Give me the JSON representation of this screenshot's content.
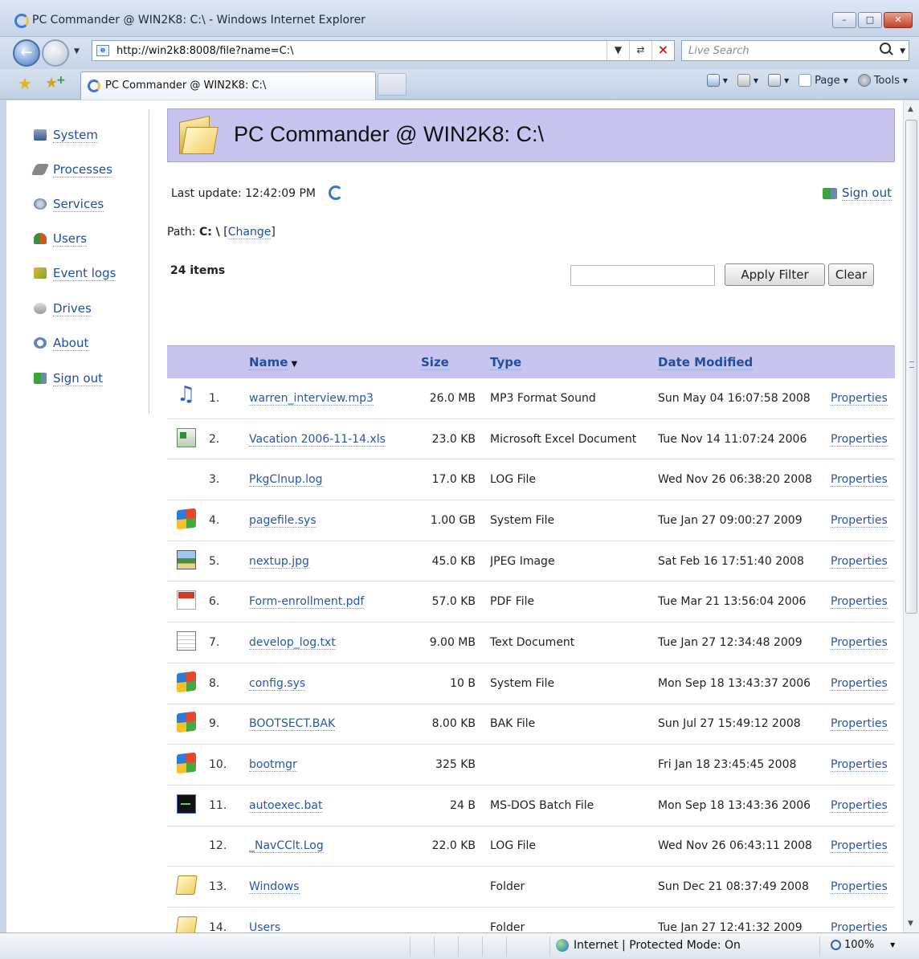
{
  "window": {
    "title": "PC Commander @ WIN2K8: C:\\ - Windows Internet Explorer",
    "minimize": "–",
    "maximize": "□",
    "close": "✕"
  },
  "address_bar": {
    "url": "http://win2k8:8008/file?name=C:\\",
    "search_placeholder": "Live Search"
  },
  "tab": {
    "label": "PC Commander @ WIN2K8: C:\\"
  },
  "command_bar": {
    "page_label": "Page",
    "tools_label": "Tools"
  },
  "sidebar": {
    "items": [
      {
        "label": "System",
        "icon": "system-icon"
      },
      {
        "label": "Processes",
        "icon": "processes-icon"
      },
      {
        "label": "Services",
        "icon": "services-icon"
      },
      {
        "label": "Users",
        "icon": "users-icon"
      },
      {
        "label": "Event logs",
        "icon": "event-logs-icon"
      },
      {
        "label": "Drives",
        "icon": "drives-icon"
      },
      {
        "label": "About",
        "icon": "about-icon"
      },
      {
        "label": "Sign out",
        "icon": "sign-out-icon"
      }
    ]
  },
  "header": {
    "title": "PC Commander @ WIN2K8: C:\\"
  },
  "status": {
    "last_update_label": "Last update:",
    "last_update_time": "12:42:09 PM",
    "sign_out": "Sign out"
  },
  "path": {
    "label": "Path:",
    "value": "C: \\",
    "change_link": "Change"
  },
  "listing": {
    "count": "24 items",
    "filter_value": "",
    "apply_filter": "Apply Filter",
    "clear": "Clear",
    "columns": {
      "name": "Name",
      "size": "Size",
      "type": "Type",
      "date": "Date Modified"
    },
    "properties_label": "Properties",
    "rows": [
      {
        "n": "1.",
        "icon": "audio-file-icon",
        "name": "warren_interview.mp3",
        "size": "26.0 MB",
        "type": "MP3 Format Sound",
        "date": "Sun May 04 16:07:58 2008"
      },
      {
        "n": "2.",
        "icon": "excel-file-icon",
        "name": "Vacation 2006-11-14.xls",
        "size": "23.0 KB",
        "type": "Microsoft Excel Document",
        "date": "Tue Nov 14 11:07:24 2006"
      },
      {
        "n": "3.",
        "icon": "",
        "name": "PkgClnup.log",
        "size": "17.0 KB",
        "type": "LOG File",
        "date": "Wed Nov 26 06:38:20 2008"
      },
      {
        "n": "4.",
        "icon": "windows-file-icon",
        "name": "pagefile.sys",
        "size": "1.00 GB",
        "type": "System File",
        "date": "Tue Jan 27 09:00:27 2009"
      },
      {
        "n": "5.",
        "icon": "image-file-icon",
        "name": "nextup.jpg",
        "size": "45.0 KB",
        "type": "JPEG Image",
        "date": "Sat Feb 16 17:51:40 2008"
      },
      {
        "n": "6.",
        "icon": "pdf-file-icon",
        "name": "Form-enrollment.pdf",
        "size": "57.0 KB",
        "type": "PDF File",
        "date": "Tue Mar 21 13:56:04 2006"
      },
      {
        "n": "7.",
        "icon": "text-file-icon",
        "name": "develop_log.txt",
        "size": "9.00 MB",
        "type": "Text Document",
        "date": "Tue Jan 27 12:34:48 2009"
      },
      {
        "n": "8.",
        "icon": "windows-file-icon",
        "name": "config.sys",
        "size": "10 B",
        "type": "System File",
        "date": "Mon Sep 18 13:43:37 2006"
      },
      {
        "n": "9.",
        "icon": "windows-file-icon",
        "name": "BOOTSECT.BAK",
        "size": "8.00 KB",
        "type": "BAK File",
        "date": "Sun Jul 27 15:49:12 2008"
      },
      {
        "n": "10.",
        "icon": "windows-file-icon",
        "name": "bootmgr",
        "size": "325 KB",
        "type": "",
        "date": "Fri Jan 18 23:45:45 2008"
      },
      {
        "n": "11.",
        "icon": "batch-file-icon",
        "name": "autoexec.bat",
        "size": "24 B",
        "type": "MS-DOS Batch File",
        "date": "Mon Sep 18 13:43:36 2006"
      },
      {
        "n": "12.",
        "icon": "",
        "name": "_NavCClt.Log",
        "size": "22.0 KB",
        "type": "LOG File",
        "date": "Wed Nov 26 06:43:11 2008"
      },
      {
        "n": "13.",
        "icon": "folder-icon",
        "name": "Windows",
        "size": "",
        "type": "Folder",
        "date": "Sun Dec 21 08:37:49 2008"
      },
      {
        "n": "14.",
        "icon": "folder-icon",
        "name": "Users",
        "size": "",
        "type": "Folder",
        "date": "Tue Jan 27 12:41:32 2009"
      }
    ]
  },
  "statusbar": {
    "zone": "Internet | Protected Mode: On",
    "zoom": "100%"
  }
}
